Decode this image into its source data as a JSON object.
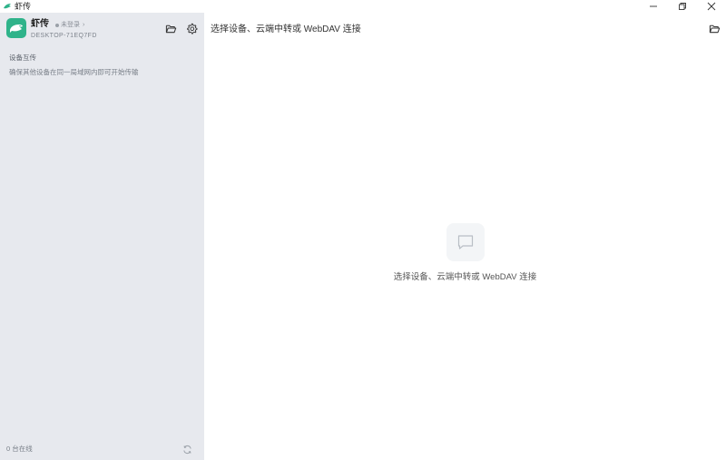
{
  "window": {
    "title": "虾传",
    "controls": {
      "minimize_icon": "minimize-icon",
      "restore_icon": "restore-icon",
      "close_icon": "close-icon"
    }
  },
  "sidebar": {
    "profile": {
      "name": "虾传",
      "login_status": "未登录",
      "login_chevron": "›",
      "device_name": "DESKTOP-71EQ7FD",
      "avatar_icon": "shrimp-logo-icon",
      "avatar_color": "#2fb38a"
    },
    "actions": {
      "open_folder_icon": "folder-open-icon",
      "settings_icon": "gear-icon"
    },
    "section_title": "设备互传",
    "section_hint": "确保其他设备在同一局域网内即可开始传输",
    "online_count": "0 台在线",
    "refresh_icon": "refresh-icon",
    "background": "#e7e9ee"
  },
  "main": {
    "header_title": "选择设备、云端中转或 WebDAV 连接",
    "open_folder_icon": "folder-open-icon",
    "empty_state": {
      "icon": "chat-bubble-icon",
      "text": "选择设备、云端中转或 WebDAV 连接"
    }
  }
}
